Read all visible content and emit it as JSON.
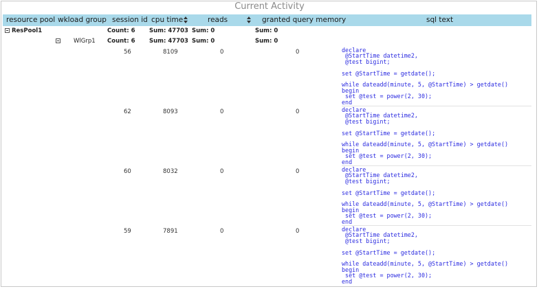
{
  "report": {
    "title": "Current Activity",
    "columns": [
      {
        "label": "resource pool"
      },
      {
        "label": "wkload group"
      },
      {
        "label": "session id"
      },
      {
        "label": "cpu time"
      },
      {
        "label": "reads"
      },
      {
        "label": "granted query memory"
      },
      {
        "label": "sql text"
      }
    ],
    "pool": {
      "name": "ResPool1",
      "count": "Count: 6",
      "cpu_sum": "Sum: 47703",
      "reads_sum": "Sum: 0",
      "mem_sum": "Sum: 0"
    },
    "group": {
      "name": "WlGrp1",
      "count": "Count: 6",
      "cpu_sum": "Sum: 47703",
      "reads_sum": "Sum: 0",
      "mem_sum": "Sum: 0"
    },
    "rows": [
      {
        "session_id": "56",
        "cpu_time": "8109",
        "reads": "0",
        "granted_memory": "0",
        "sql_text": "declare\n @StartTime datetime2,\n @test bigint;\n\nset @StartTime = getdate();\n\nwhile dateadd(minute, 5, @StartTime) > getdate()\nbegin\n set @test = power(2, 30);\nend"
      },
      {
        "session_id": "62",
        "cpu_time": "8093",
        "reads": "0",
        "granted_memory": "0",
        "sql_text": "declare\n @StartTime datetime2,\n @test bigint;\n\nset @StartTime = getdate();\n\nwhile dateadd(minute, 5, @StartTime) > getdate()\nbegin\n set @test = power(2, 30);\nend"
      },
      {
        "session_id": "60",
        "cpu_time": "8032",
        "reads": "0",
        "granted_memory": "0",
        "sql_text": "declare\n @StartTime datetime2,\n @test bigint;\n\nset @StartTime = getdate();\n\nwhile dateadd(minute, 5, @StartTime) > getdate()\nbegin\n set @test = power(2, 30);\nend"
      },
      {
        "session_id": "59",
        "cpu_time": "7891",
        "reads": "0",
        "granted_memory": "0",
        "sql_text": "declare\n @StartTime datetime2,\n @test bigint;\n\nset @StartTime = getdate();\n\nwhile dateadd(minute, 5, @StartTime) > getdate()\nbegin\n set @test = power(2, 30);\nend"
      }
    ],
    "colors": {
      "header_bg": "#a9d9ea",
      "sql_text": "#2a2ae0",
      "title": "#8a8a8a"
    }
  }
}
